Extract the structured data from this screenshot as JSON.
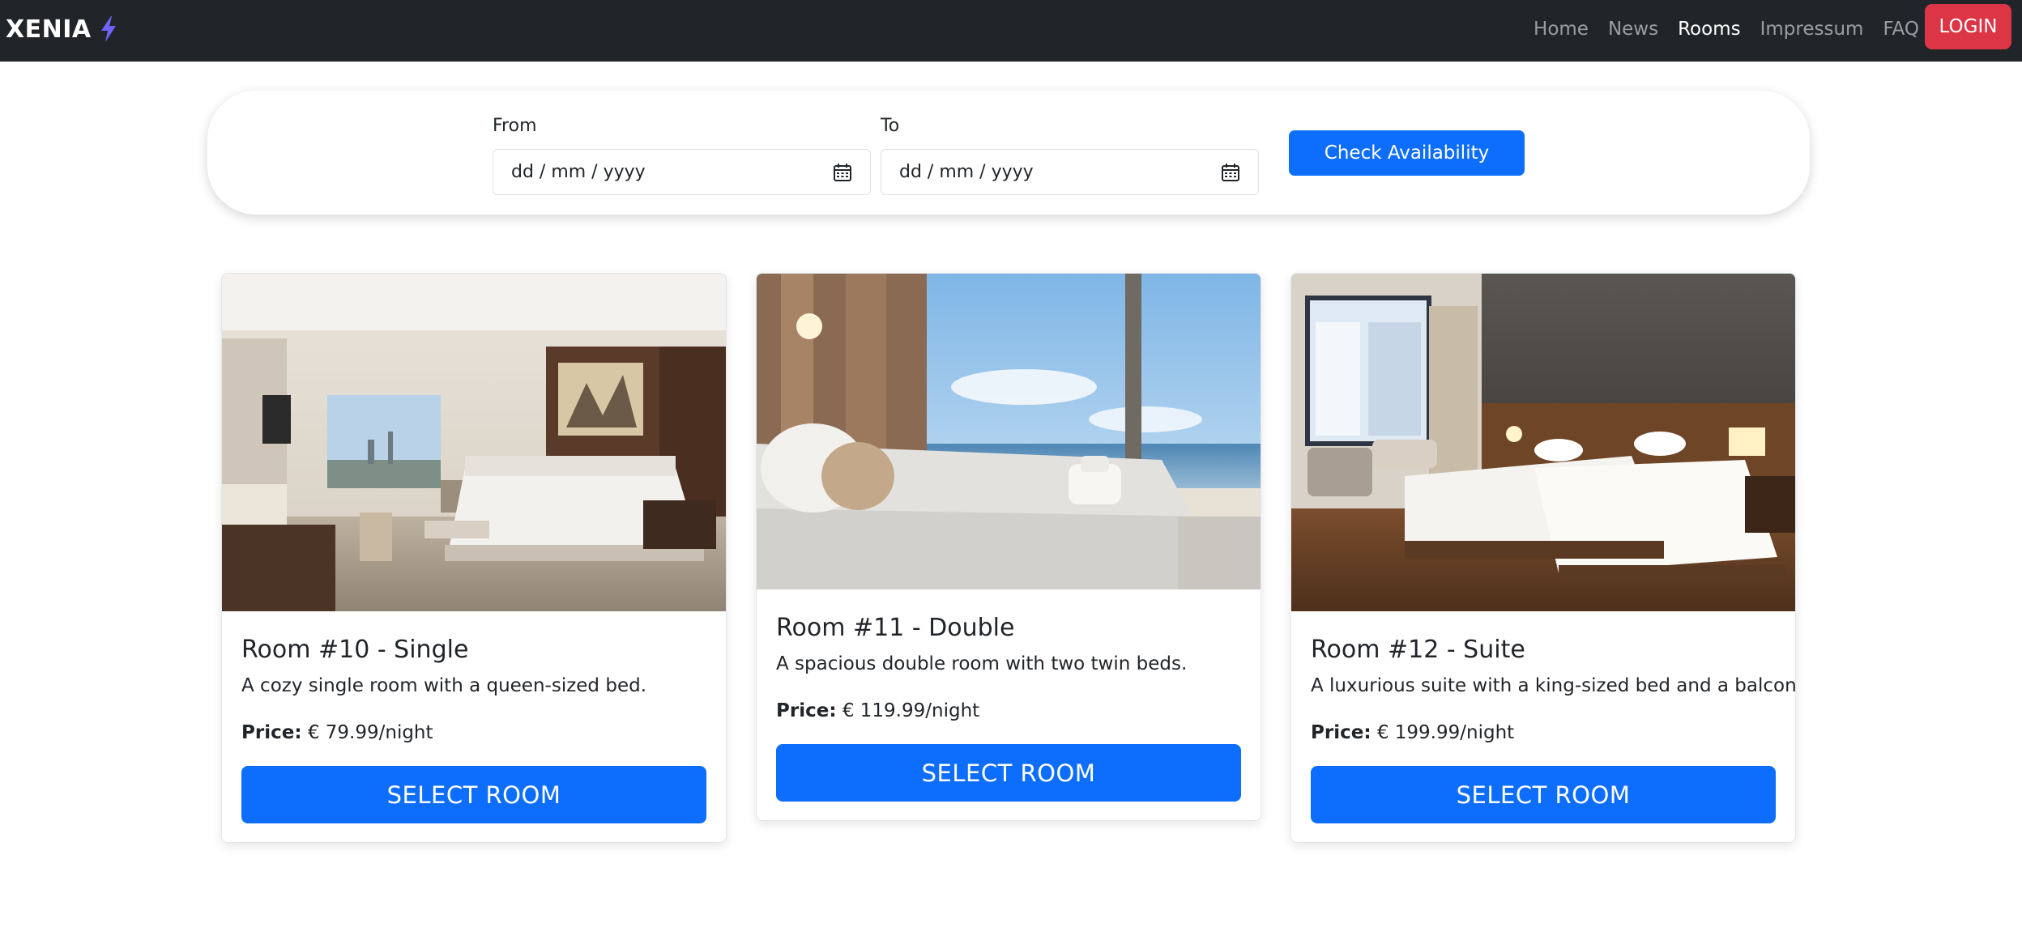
{
  "navbar": {
    "brand": "XENIA",
    "links": [
      {
        "label": "Home",
        "active": false
      },
      {
        "label": "News",
        "active": false
      },
      {
        "label": "Rooms",
        "active": true
      },
      {
        "label": "Impressum",
        "active": false
      },
      {
        "label": "FAQ",
        "active": false
      }
    ],
    "login_label": "LOGIN"
  },
  "search": {
    "from_label": "From",
    "from_placeholder": "dd / mm / yyyy",
    "to_label": "To",
    "to_placeholder": "dd / mm / yyyy",
    "button_label": "Check Availability"
  },
  "rooms": [
    {
      "title": "Room #10 - Single",
      "description": "A cozy single room with a queen-sized bed.",
      "price_label": "Price:",
      "price": "€ 79.99/night",
      "button_label": "SELECT ROOM",
      "image": "hotel-room-single-photo"
    },
    {
      "title": "Room #11 - Double",
      "description": "A spacious double room with two twin beds.",
      "price_label": "Price:",
      "price": "€ 119.99/night",
      "button_label": "SELECT ROOM",
      "image": "hotel-room-beach-view-photo"
    },
    {
      "title": "Room #12 - Suite",
      "description": "A luxurious suite with a king-sized bed and a balcony.",
      "price_label": "Price:",
      "price": "€ 199.99/night",
      "button_label": "SELECT ROOM",
      "image": "hotel-room-twin-beds-photo"
    }
  ],
  "colors": {
    "navbar_bg": "#212529",
    "primary": "#0d6efd",
    "danger": "#dc3545",
    "brand_icon": "#6f63ff"
  }
}
